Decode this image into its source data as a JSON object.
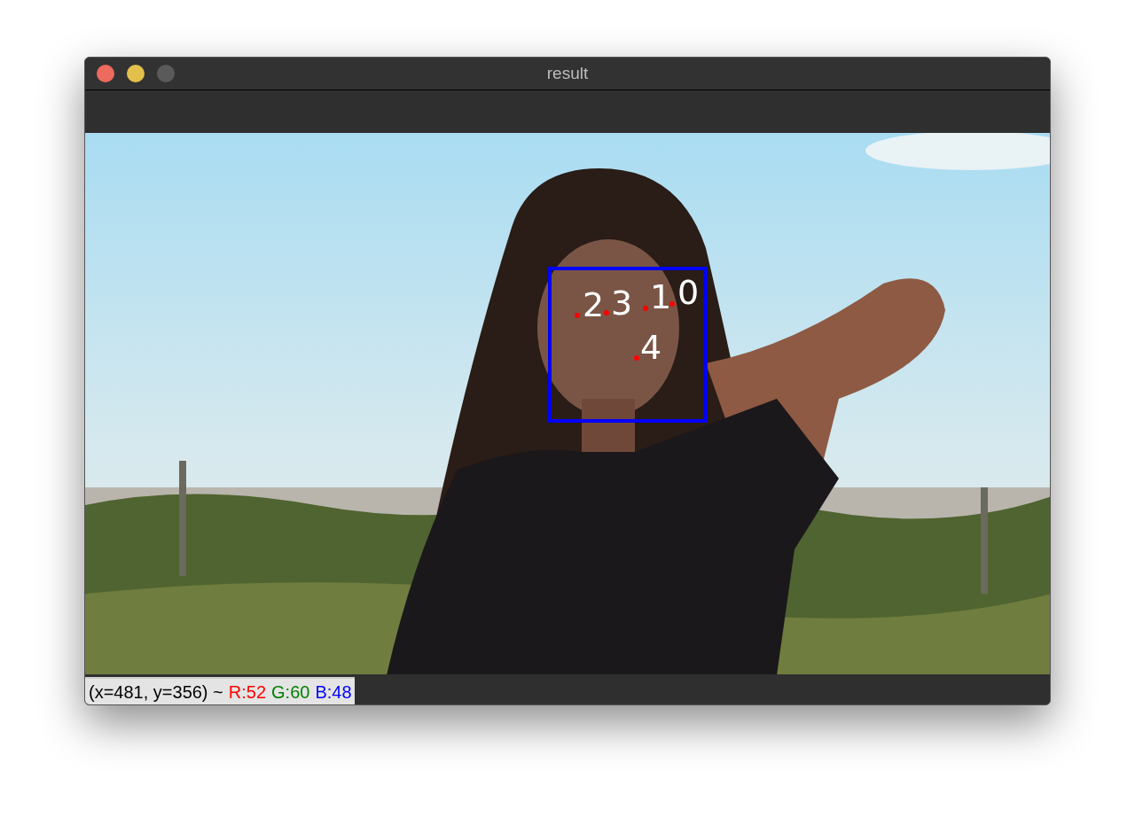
{
  "window": {
    "title": "result",
    "buttons": [
      {
        "kind": "close",
        "disabled": false
      },
      {
        "kind": "minimize",
        "disabled": false
      },
      {
        "kind": "zoom",
        "disabled": true
      }
    ]
  },
  "image": {
    "face_box": true,
    "landmarks": [
      {
        "label": "2"
      },
      {
        "label": "3"
      },
      {
        "label": "1"
      },
      {
        "label": "0"
      },
      {
        "label": "4"
      }
    ]
  },
  "status_bar": {
    "position": "(x=481, y=356) ~",
    "channels": [
      {
        "text": "R:52",
        "color": "#ff0000"
      },
      {
        "text": "G:60",
        "color": "#008000"
      },
      {
        "text": "B:48",
        "color": "#0000ff"
      }
    ]
  }
}
